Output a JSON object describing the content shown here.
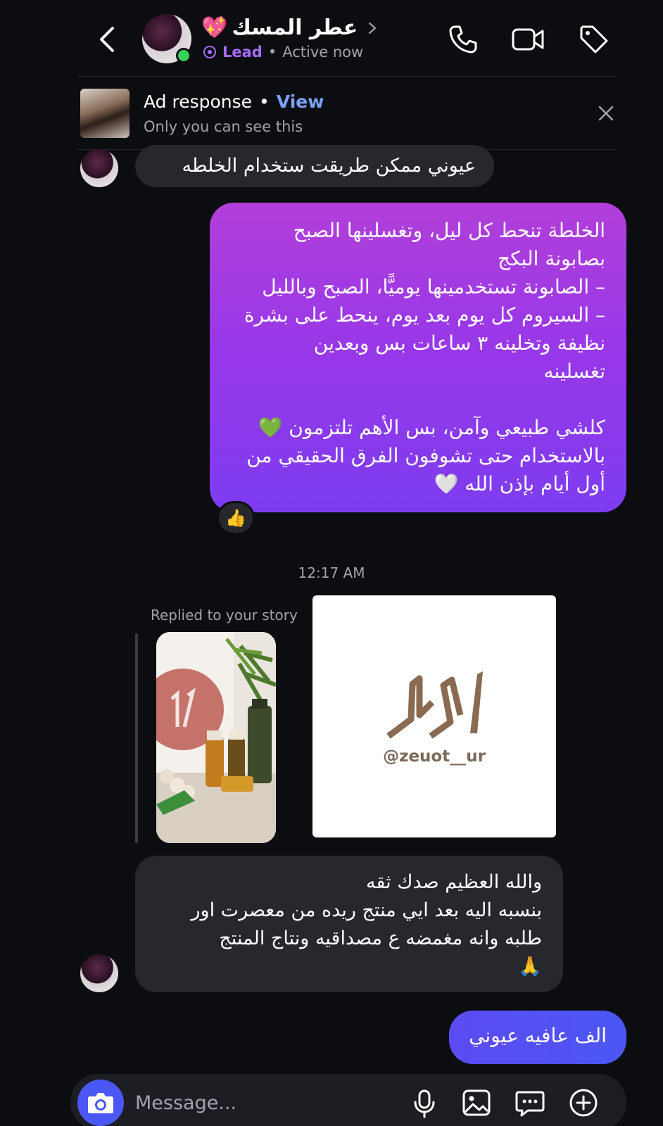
{
  "header": {
    "contact_emoji": "💖",
    "contact_name": "عطر المسك",
    "lead_label": "Lead",
    "status": "Active now",
    "separator": "•"
  },
  "ad_response": {
    "title": "Ad response",
    "separator": "•",
    "view_label": "View",
    "subtitle": "Only you can see this"
  },
  "messages": {
    "m1": {
      "text": "عيوني ممكن طريقت ستخدام الخلطه"
    },
    "m2": {
      "lines": [
        "الخلطة تنحط كل ليل، وتغسلينها الصبح",
        "بصابونة البكج",
        "– الصابونة تستخدمينها يوميًّا، الصبح وبالليل",
        "– السيروم كل يوم بعد يوم، ينحط على بشرة",
        "نظيفة وتخلينه ٣ ساعات بس وبعدين",
        "تغسلينه",
        "",
        "كلشي طبيعي وآمن، بس الأهم تلتزمون 💚",
        "بالاستخدام حتى تشوفون الفرق الحقيقي من",
        "أول أيام بإذن الله 🤍"
      ],
      "reaction": "👍"
    },
    "timestamp": "12:17 AM",
    "story_reply": {
      "label": "Replied to your story",
      "handle": "@zeuot__ur"
    },
    "m3": {
      "lines": [
        "والله العظيم صدك ثقه",
        "بنسبه اليه بعد ايي منتج ريده من معصرت اور",
        "طلبه وانه مغمضه ع مصداقيه ونتاج المنتج",
        "🙏"
      ]
    },
    "m4": {
      "text": "الف عافيه عيوني"
    }
  },
  "composer": {
    "placeholder": "Message..."
  },
  "icons": {
    "back": "chevron-left-icon",
    "call": "phone-icon",
    "video": "video-camera-icon",
    "label": "tag-icon",
    "close": "close-icon",
    "camera": "camera-icon",
    "mic": "microphone-icon",
    "gallery": "image-icon",
    "sticker": "chat-bubble-icon",
    "more": "plus-circle-icon"
  },
  "colors": {
    "background": "#0c0d11",
    "incoming_bubble": "#26282e",
    "outgoing_gradient_top": "#b23fd9",
    "outgoing_gradient_bottom": "#7d3cf0",
    "outgoing_blue": "#4b57f5",
    "lead": "#a56cff",
    "link": "#7aa2ff",
    "online": "#36d15b"
  }
}
